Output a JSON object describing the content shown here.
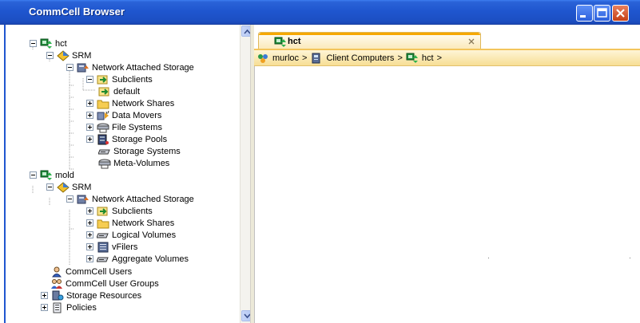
{
  "window": {
    "title": "CommCell Browser"
  },
  "tree": {
    "hct": "hct",
    "hct_srm": "SRM",
    "hct_nas": "Network Attached Storage",
    "hct_subclients": "Subclients",
    "hct_default": "default",
    "hct_network_shares": "Network Shares",
    "hct_data_movers": "Data Movers",
    "hct_file_systems": "File Systems",
    "hct_storage_pools": "Storage Pools",
    "hct_storage_systems": "Storage Systems",
    "hct_meta_volumes": "Meta-Volumes",
    "mold": "mold",
    "mold_srm": "SRM",
    "mold_nas": "Network Attached Storage",
    "mold_subclients": "Subclients",
    "mold_network_shares": "Network Shares",
    "mold_logical_volumes": "Logical Volumes",
    "mold_vfilers": "vFilers",
    "mold_aggregate_volumes": "Aggregate Volumes",
    "commcell_users": "CommCell Users",
    "commcell_user_groups": "CommCell User Groups",
    "storage_resources": "Storage Resources",
    "policies": "Policies"
  },
  "tab": {
    "label": "hct"
  },
  "breadcrumb": {
    "item1": "murloc",
    "sep": ">",
    "item2": "Client Computers",
    "item3": "hct"
  },
  "colors": {
    "titlebar": "#1f56cf",
    "tab_accent": "#f6a800",
    "breadcrumb_bg": "#f7de95"
  }
}
